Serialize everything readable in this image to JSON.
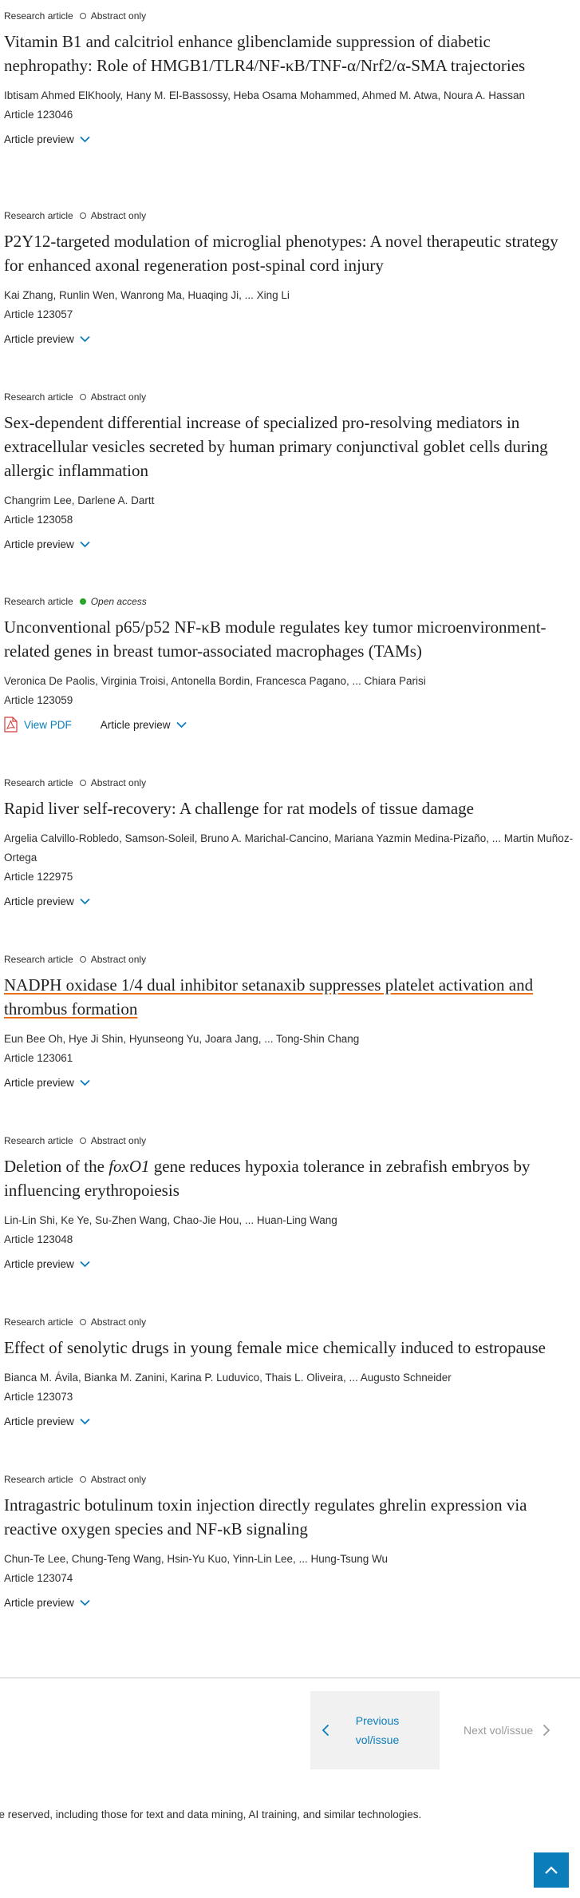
{
  "articles": [
    {
      "type": "Research article",
      "access": "Abstract only",
      "open": false,
      "title": "Vitamin B1 and calcitriol enhance glibenclamide suppression of diabetic nephropathy: Role of HMGB1/TLR4/NF-κB/TNF-α/Nrf2/α-SMA trajectories",
      "authors": "Ibtisam Ahmed ElKhooly, Hany M. El-Bassossy, Heba Osama Mohammed, Ahmed M. Atwa, Noura A. Hassan",
      "article_no": "Article 123046",
      "preview": "Article preview"
    },
    {
      "type": "Research article",
      "access": "Abstract only",
      "open": false,
      "title": "P2Y12-targeted modulation of microglial phenotypes: A novel therapeutic strategy for enhanced axonal regeneration post-spinal cord injury",
      "authors": "Kai Zhang, Runlin Wen, Wanrong Ma, Huaqing Ji, ... Xing Li",
      "article_no": "Article 123057",
      "preview": "Article preview"
    },
    {
      "type": "Research article",
      "access": "Abstract only",
      "open": false,
      "title": "Sex-dependent differential increase of specialized pro-resolving mediators in extracellular vesicles secreted by human primary conjunctival goblet cells during allergic inflammation",
      "authors": "Changrim Lee, Darlene A. Dartt",
      "article_no": "Article 123058",
      "preview": "Article preview"
    },
    {
      "type": "Research article",
      "access": "Open access",
      "open": true,
      "title": "Unconventional p65/p52 NF-κB module regulates key tumor microenvironment-related genes in breast tumor-associated macrophages (TAMs)",
      "authors": "Veronica De Paolis, Virginia Troisi, Antonella Bordin, Francesca Pagano, ... Chiara Parisi",
      "article_no": "Article 123059",
      "preview": "Article preview",
      "pdf": "View PDF"
    },
    {
      "type": "Research article",
      "access": "Abstract only",
      "open": false,
      "title": "Rapid liver self-recovery: A challenge for rat models of tissue damage",
      "authors": "Argelia Calvillo-Robledo, Samson-Soleil, Bruno A. Marichal-Cancino, Mariana Yazmin Medina-Pizaño, ... Martin Muñoz-Ortega",
      "article_no": "Article 122975",
      "preview": "Article preview"
    },
    {
      "type": "Research article",
      "access": "Abstract only",
      "open": false,
      "title": "NADPH oxidase 1/4 dual inhibitor setanaxib suppresses platelet activation and thrombus formation",
      "authors": "Eun Bee Oh, Hye Ji Shin, Hyunseong Yu, Joara Jang, ... Tong-Shin Chang",
      "article_no": "Article 123061",
      "preview": "Article preview",
      "hover": true
    },
    {
      "type": "Research article",
      "access": "Abstract only",
      "open": false,
      "title_pre": "Deletion of the ",
      "title_italic": "foxO1",
      "title_post": " gene reduces hypoxia tolerance in zebrafish embryos by influencing erythropoiesis",
      "authors": "Lin-Lin Shi, Ke Ye, Su-Zhen Wang, Chao-Jie Hou, ... Huan-Ling Wang",
      "article_no": "Article 123048",
      "preview": "Article preview"
    },
    {
      "type": "Research article",
      "access": "Abstract only",
      "open": false,
      "title": "Effect of senolytic drugs in young female mice chemically induced to estropause",
      "authors": "Bianca M. Ávila, Bianka M. Zanini, Karina P. Luduvico, Thais L. Oliveira, ... Augusto Schneider",
      "article_no": "Article 123073",
      "preview": "Article preview"
    },
    {
      "type": "Research article",
      "access": "Abstract only",
      "open": false,
      "title": "Intragastric botulinum toxin injection directly regulates ghrelin expression via reactive oxygen species and NF-κB signaling",
      "authors": "Chun-Te Lee, Chung-Teng Wang, Hsin-Yu Kuo, Yinn-Lin Lee, ... Hung-Tsung Wu",
      "article_no": "Article 123074",
      "preview": "Article preview"
    }
  ],
  "pagination": {
    "previous_line1": "Previous",
    "previous_line2": "vol/issue",
    "next": "Next vol/issue"
  },
  "footer": {
    "text": "re reserved, including those for text and data mining, AI training, and similar technologies."
  },
  "colors": {
    "link": "#0c7dbb",
    "open_access": "#29a329",
    "hover_underline": "#e9711c"
  },
  "icons": {
    "preview": "chevron-down-icon",
    "pdf": "pdf-icon",
    "previous": "chevron-left-icon",
    "next": "chevron-right-icon",
    "back_to_top": "arrow-up-icon"
  }
}
